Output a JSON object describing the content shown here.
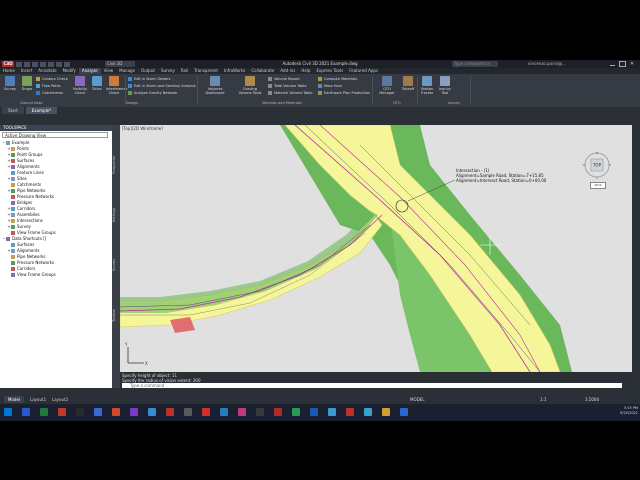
{
  "title_bar": {
    "app_logo": "C3D",
    "workspace": "Civil 3D",
    "window_title": "Autodesk Civil 3D 2021   Example.dwg",
    "search_placeholder": "Type a keyword or phrase",
    "user": "vincenzo.parisi@..."
  },
  "ribbon_tabs": [
    "Home",
    "Insert",
    "Annotate",
    "Modify",
    "Analyze",
    "View",
    "Manage",
    "Output",
    "Survey",
    "Rail",
    "Transparent",
    "InfraWorks",
    "Collaborate",
    "Add-ins",
    "Help",
    "Express Tools",
    "Featured Apps"
  ],
  "active_ribbon_tab": "Analyze",
  "ribbon": {
    "ground_data": {
      "title": "Ground Data",
      "survey": "Survey",
      "drape": "Drape",
      "contour_check": "Contour Check",
      "flow_paths": "Flow Paths",
      "catchments": "Catchments",
      "visibility_check": "Visibility Check",
      "drive": "Drive",
      "interference_check": "Interference Check"
    },
    "design": {
      "title": "Design",
      "edit_storm_sewers": "Edit in Storm Sewers",
      "edit_storm_sanitary": "Edit in Storm and Sanitary Analysis",
      "analyze_gravity": "Analyze Gravity Network"
    },
    "volumes": {
      "title": "Volumes and Materials",
      "volumes_dashboard": "Volumes Dashboard",
      "grading_tools": "Grading Volume Tools",
      "volume_report": "Volume Report",
      "total_volume_table": "Total Volume Table",
      "material_volume_table": "Material Volume Table",
      "compute_materials": "Compute Materials",
      "mass_haul": "Mass Haul",
      "earthwork_plan": "Earthwork Plan Production"
    },
    "qto": {
      "title": "QTO",
      "qto_manager": "QTO Manager",
      "takeoff": "Takeoff"
    },
    "inquiry": {
      "title": "Inquiry",
      "station_tracker": "Station Tracker",
      "inquiry_tool": "Inquiry Tool"
    }
  },
  "doc_tabs": [
    "Start",
    "Example*"
  ],
  "active_doc_tab": "Example*",
  "toolspace": {
    "title": "TOOLSPACE",
    "view_selector": "Active Drawing View",
    "tree": [
      {
        "label": "Example",
        "level": 0,
        "toggle": "−"
      },
      {
        "label": "Points",
        "level": 1,
        "toggle": "+"
      },
      {
        "label": "Point Groups",
        "level": 1,
        "toggle": "+"
      },
      {
        "label": "Surfaces",
        "level": 1,
        "toggle": "+"
      },
      {
        "label": "Alignments",
        "level": 1,
        "toggle": "+"
      },
      {
        "label": "Feature Lines",
        "level": 1,
        "toggle": ""
      },
      {
        "label": "Sites",
        "level": 1,
        "toggle": "+"
      },
      {
        "label": "Catchments",
        "level": 1,
        "toggle": ""
      },
      {
        "label": "Pipe Networks",
        "level": 1,
        "toggle": "+"
      },
      {
        "label": "Pressure Networks",
        "level": 1,
        "toggle": ""
      },
      {
        "label": "Bridges",
        "level": 1,
        "toggle": ""
      },
      {
        "label": "Corridors",
        "level": 1,
        "toggle": "+"
      },
      {
        "label": "Assemblies",
        "level": 1,
        "toggle": "+"
      },
      {
        "label": "Intersections",
        "level": 1,
        "toggle": "+"
      },
      {
        "label": "Survey",
        "level": 1,
        "toggle": "+"
      },
      {
        "label": "View Frame Groups",
        "level": 1,
        "toggle": ""
      },
      {
        "label": "Data Shortcuts []",
        "level": 0,
        "toggle": "−"
      },
      {
        "label": "Surfaces",
        "level": 1,
        "toggle": ""
      },
      {
        "label": "Alignments",
        "level": 1,
        "toggle": "+"
      },
      {
        "label": "Pipe Networks",
        "level": 1,
        "toggle": ""
      },
      {
        "label": "Pressure Networks",
        "level": 1,
        "toggle": ""
      },
      {
        "label": "Corridors",
        "level": 1,
        "toggle": ""
      },
      {
        "label": "View Frame Groups",
        "level": 1,
        "toggle": ""
      }
    ]
  },
  "side_tabs": [
    "Prospector",
    "Settings",
    "Survey",
    "Toolbox"
  ],
  "drawing": {
    "view_label": "[Top][2D Wireframe]",
    "annotation": {
      "line1": "Intersection - (1)",
      "line2": "Alignment=Sample Road, Station=7+15.85",
      "line3": "Alignment=Intersect Road, Station=0+00.00"
    }
  },
  "viewcube": {
    "face": "TOP",
    "wcs": "WCS",
    "n": "N",
    "s": "S",
    "e": "E",
    "w": "W"
  },
  "command": {
    "history1": "Specify height of object: 11",
    "history2": "Specify the radius of vision extent: 300",
    "placeholder": "Type a command"
  },
  "layout_tabs": [
    "Model",
    "Layout1",
    "Layout2"
  ],
  "active_layout": "Model",
  "status": {
    "model": "MODEL",
    "scale": "1:1",
    "zoom": "3.5000"
  },
  "taskbar": {
    "time": "3:15 PM",
    "date": "9/25/2021"
  },
  "colors": {
    "accent_active_tab": "#3a4150",
    "road_yellow": "#f5f59a",
    "grade_green": "#6bb85c",
    "daylight_red": "#e0505a",
    "alignment_magenta": "#c02aa0"
  }
}
